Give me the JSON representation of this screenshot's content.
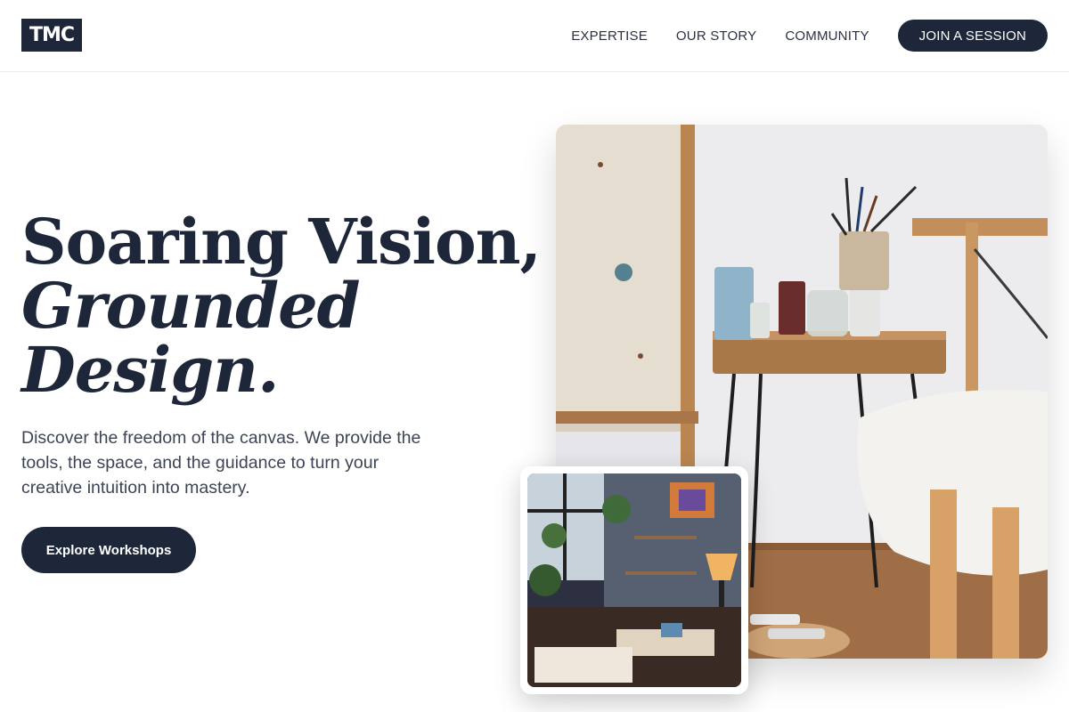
{
  "brand": {
    "logo_text": "TMC"
  },
  "nav": {
    "links": [
      "EXPERTISE",
      "OUR STORY",
      "COMMUNITY"
    ],
    "cta_label": "JOIN A SESSION"
  },
  "hero": {
    "headline_line1": "Soaring Vision,",
    "headline_line2": "Grounded",
    "headline_line3": "Design.",
    "description": "Discover the freedom of the canvas. We provide the tools, the space, and the guidance to turn your creative intuition into mastery.",
    "button_label": "Explore Workshops"
  },
  "colors": {
    "primary": "#1e2639",
    "text": "#3d4454"
  }
}
